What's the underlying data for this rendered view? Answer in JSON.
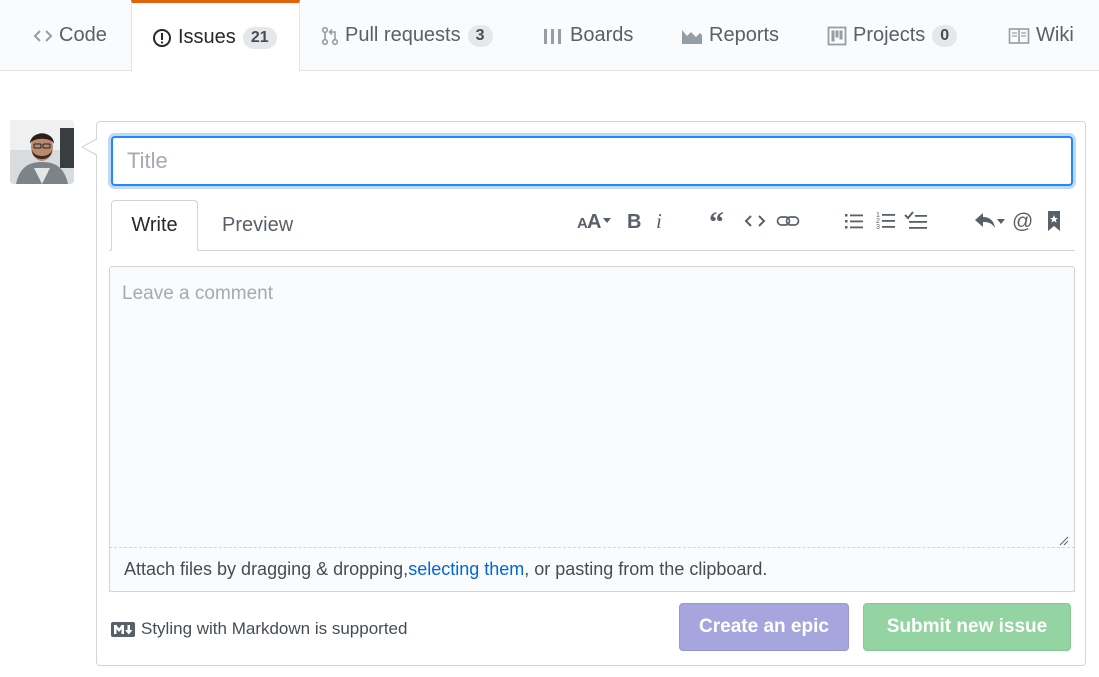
{
  "reponav": {
    "tabs": [
      {
        "id": "code",
        "label": "Code",
        "counter": null,
        "icon": "code-icon"
      },
      {
        "id": "issues",
        "label": "Issues",
        "counter": "21",
        "icon": "issue-opened-icon",
        "selected": true
      },
      {
        "id": "pulls",
        "label": "Pull requests",
        "counter": "3",
        "icon": "git-pull-request-icon"
      },
      {
        "id": "boards",
        "label": "Boards",
        "counter": null,
        "icon": "boards-icon"
      },
      {
        "id": "reports",
        "label": "Reports",
        "counter": null,
        "icon": "graph-icon"
      },
      {
        "id": "projects",
        "label": "Projects",
        "counter": "0",
        "icon": "project-icon"
      },
      {
        "id": "wiki",
        "label": "Wiki",
        "counter": null,
        "icon": "book-icon"
      }
    ]
  },
  "form": {
    "title_placeholder": "Title",
    "title_value": "",
    "tabs": {
      "write": "Write",
      "preview": "Preview"
    },
    "comment_placeholder": "Leave a comment",
    "comment_value": "",
    "toolbar": [
      "text-size-icon",
      "bold-icon",
      "italic-icon",
      "quote-icon",
      "code-icon",
      "link-icon",
      "unordered-list-icon",
      "ordered-list-icon",
      "tasklist-icon",
      "reply-icon",
      "mention-icon",
      "bookmark-icon"
    ],
    "attach": {
      "prefix": "Attach files by dragging & dropping, ",
      "link": "selecting them",
      "suffix": ", or pasting from the clipboard."
    },
    "markdown_hint": "Styling with Markdown is supported",
    "buttons": {
      "create_epic": "Create an epic",
      "submit": "Submit new issue"
    }
  },
  "colors": {
    "accent_tab_border": "#e36209",
    "focus_border": "#2188ff",
    "link": "#0366d6",
    "epic_button": "#a6a5dd",
    "submit_button": "#94d3a2"
  }
}
